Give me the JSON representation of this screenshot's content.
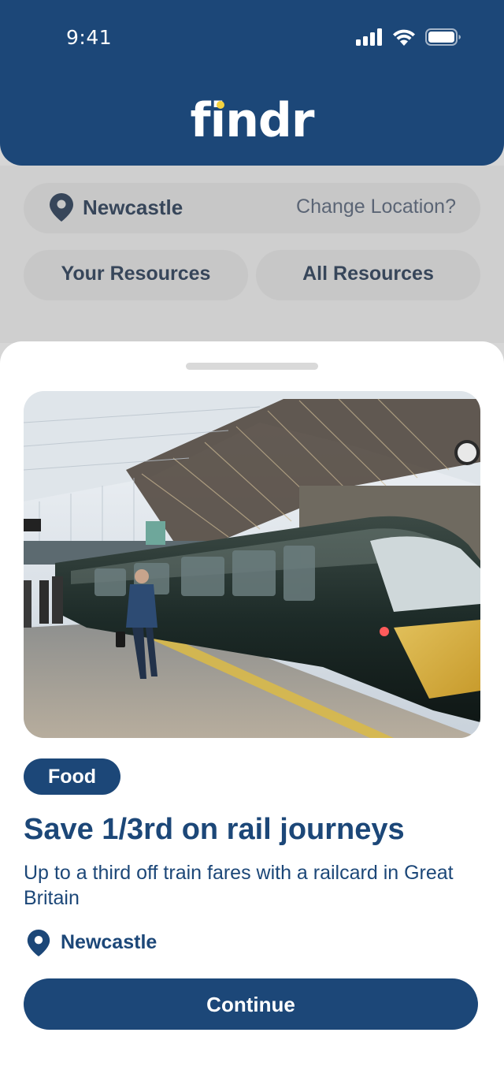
{
  "status_bar": {
    "time": "9:41"
  },
  "header": {
    "logo": "findr"
  },
  "location": {
    "name": "Newcastle",
    "change_label": "Change Location?"
  },
  "resource_tabs": [
    "Your Resources",
    "All Resources"
  ],
  "card": {
    "image_icon": "train-photo",
    "category": "Food",
    "title": "Save 1/3rd on rail journeys",
    "description": "Up to a third off train fares with a railcard in Great Britain",
    "location": "Newcastle",
    "cta_label": "Continue"
  },
  "colors": {
    "brand": "#1c4778",
    "logo_dot": "#f6d33f",
    "overlay": "#cfcfcf"
  }
}
